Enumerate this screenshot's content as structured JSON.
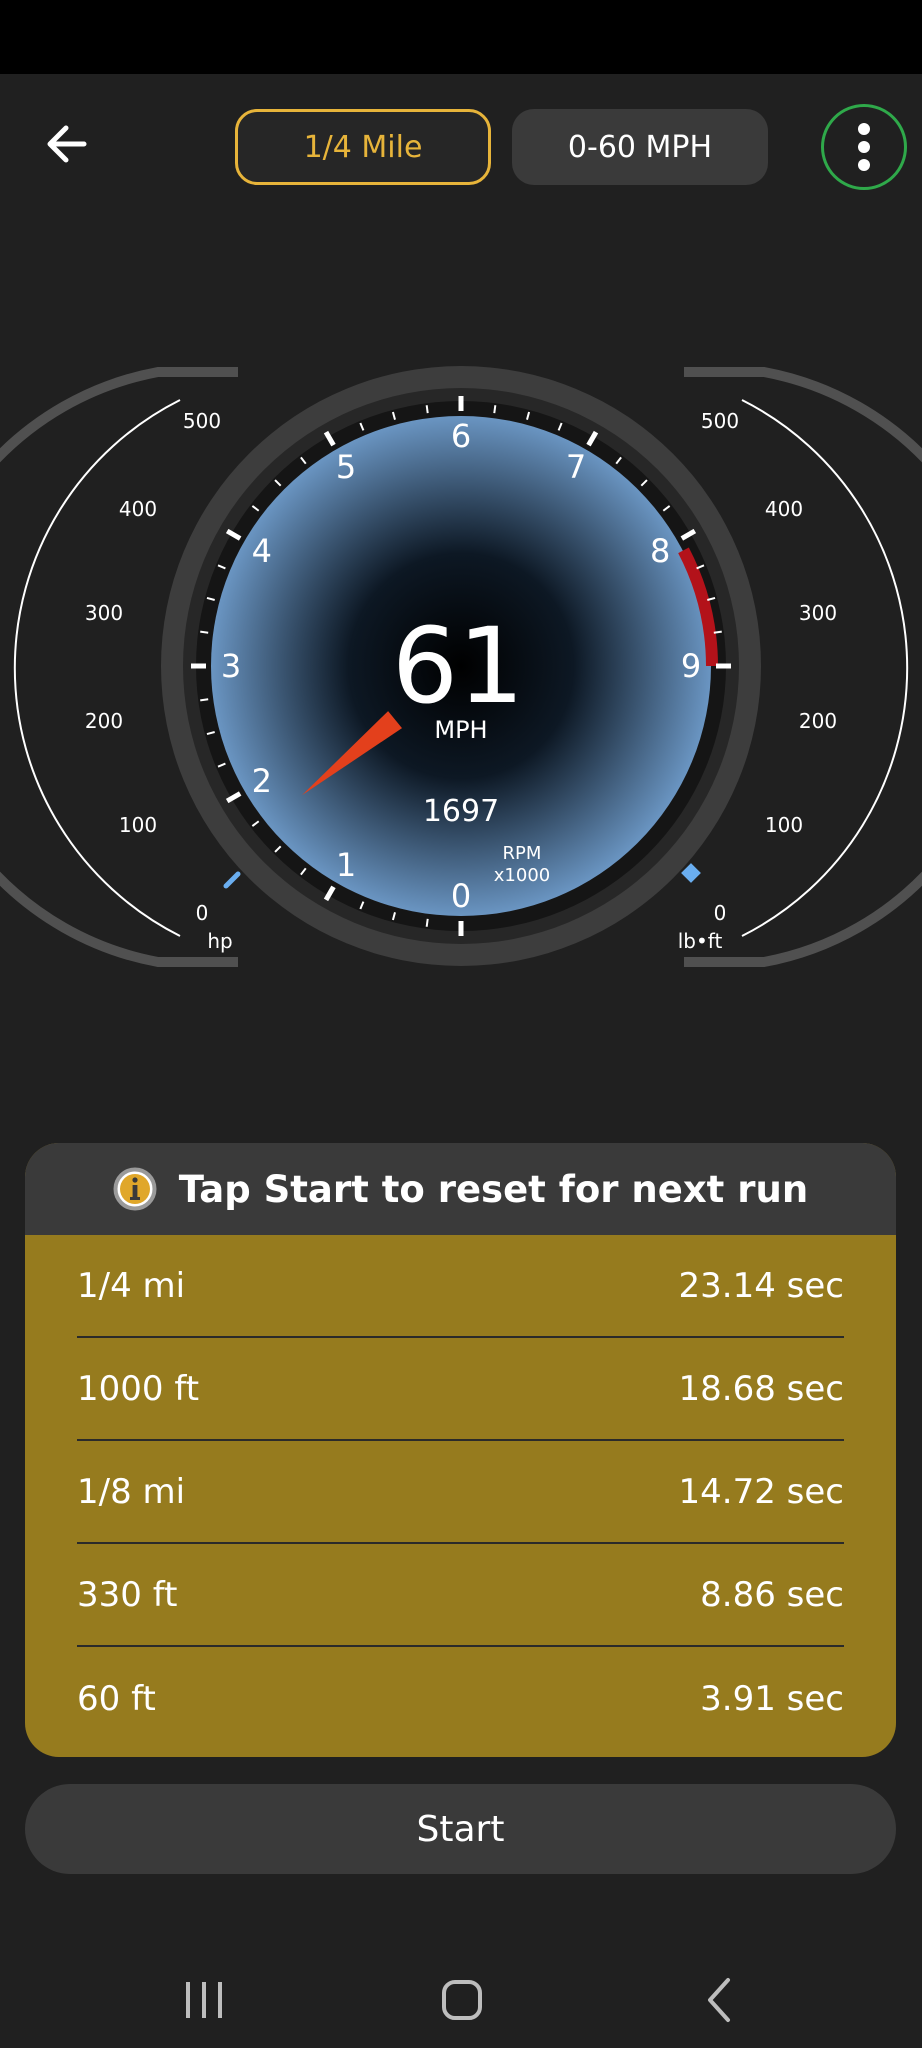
{
  "header": {
    "tabs": [
      {
        "label": "1/4 Mile",
        "active": true
      },
      {
        "label": "0-60 MPH",
        "active": false
      }
    ]
  },
  "gauge": {
    "speed": "61",
    "speed_unit": "MPH",
    "rpm": "1697",
    "rpm_unit_line1": "RPM",
    "rpm_unit_line2": "x1000",
    "rpm_ticks": [
      "0",
      "1",
      "2",
      "3",
      "4",
      "5",
      "6",
      "7",
      "8",
      "9"
    ],
    "needle_rpm_fraction": 0.1697,
    "left_scale": {
      "unit": "hp",
      "ticks": [
        "0",
        "100",
        "200",
        "300",
        "400",
        "500"
      ]
    },
    "right_scale": {
      "unit": "lb•ft",
      "ticks": [
        "0",
        "100",
        "200",
        "300",
        "400",
        "500"
      ]
    }
  },
  "info": {
    "message": "Tap Start to reset for next run"
  },
  "results": [
    {
      "label": "1/4 mi",
      "value": "23.14 sec"
    },
    {
      "label": "1000 ft",
      "value": "18.68 sec"
    },
    {
      "label": "1/8 mi",
      "value": "14.72 sec"
    },
    {
      "label": "330 ft",
      "value": "8.86 sec"
    },
    {
      "label": "60 ft",
      "value": "3.91 sec"
    }
  ],
  "start_label": "Start",
  "colors": {
    "accent": "#e7b43a",
    "panel": "#967b1e",
    "needle": "#e3401c",
    "redline": "#b3121a",
    "menu_ring": "#2fa94a"
  }
}
